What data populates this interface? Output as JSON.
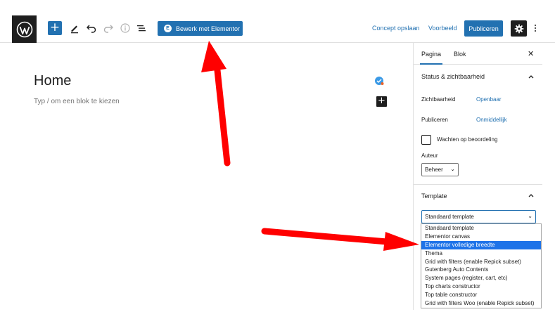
{
  "toolbar": {
    "elementor_button_label": "Bewerk met Elementor",
    "elementor_badge": "E",
    "save_draft_label": "Concept opslaan",
    "preview_label": "Voorbeeld",
    "publish_label": "Publiceren",
    "add_symbol": "+"
  },
  "editor": {
    "page_title": "Home",
    "block_placeholder": "Typ / om een blok te kiezen",
    "inline_add_symbol": "+"
  },
  "sidebar": {
    "tabs": [
      {
        "label": "Pagina",
        "active": true
      },
      {
        "label": "Blok",
        "active": false
      }
    ],
    "close_symbol": "✕",
    "status_section": {
      "title": "Status & zichtbaarheid",
      "visibility_label": "Zichtbaarheid",
      "visibility_value": "Openbaar",
      "publish_label": "Publiceren",
      "publish_value": "Onmiddellijk",
      "pending_review_label": "Wachten op beoordeling",
      "author_label": "Auteur",
      "author_value": "Beheer"
    },
    "template_section": {
      "title": "Template",
      "selected_value": "Standaard template"
    }
  },
  "template_dropdown": {
    "options": [
      "Standaard template",
      "Elementor canvas",
      "Elementor volledige breedte",
      "Thema",
      "Grid with filters (enable Repick subset)",
      "Gutenberg Auto Contents",
      "System pages (register, cart, etc)",
      "Top charts constructor",
      "Top table constructor",
      "Grid with filters Woo (enable Repick subset)"
    ],
    "highlighted_index": 2
  },
  "colors": {
    "accent": "#2271b1",
    "dark": "#1e1e1e",
    "highlight": "#1e73e8",
    "annotation_arrow": "#ff0000"
  }
}
